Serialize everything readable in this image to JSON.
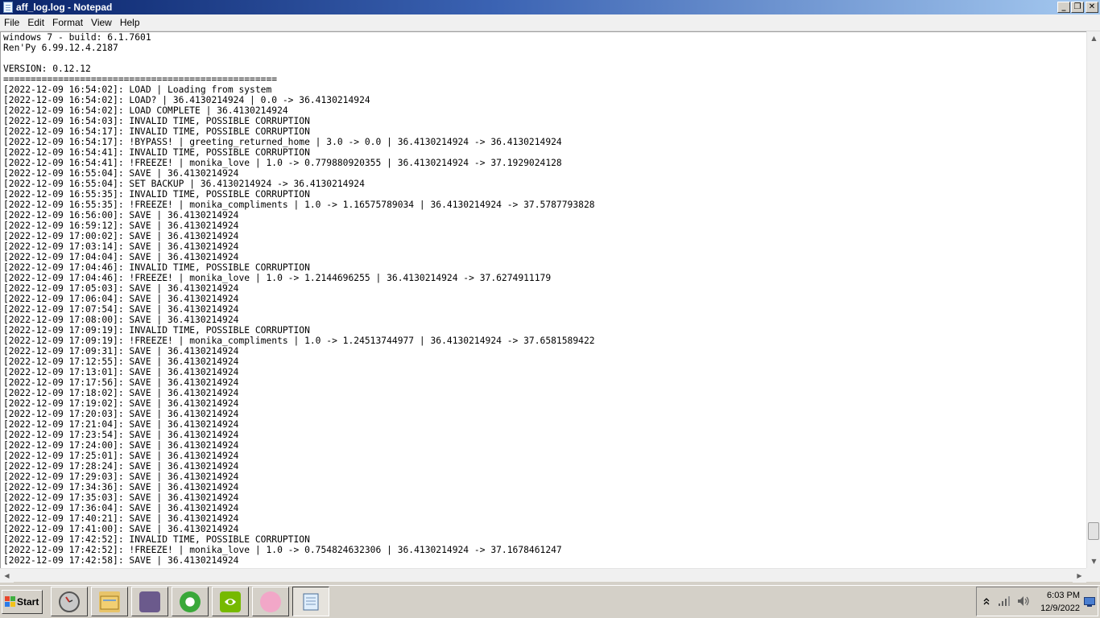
{
  "window": {
    "title": "aff_log.log - Notepad",
    "minimize_glyph": "_",
    "maximize_glyph": "❐",
    "close_glyph": "✕"
  },
  "menu": [
    "File",
    "Edit",
    "Format",
    "View",
    "Help"
  ],
  "document": {
    "lines": [
      "windows 7 - build: 6.1.7601",
      "Ren'Py 6.99.12.4.2187",
      "",
      "VERSION: 0.12.12",
      "==================================================",
      "[2022-12-09 16:54:02]: LOAD | Loading from system",
      "[2022-12-09 16:54:02]: LOAD? | 36.4130214924 | 0.0 -> 36.4130214924",
      "[2022-12-09 16:54:02]: LOAD COMPLETE | 36.4130214924",
      "[2022-12-09 16:54:03]: INVALID TIME, POSSIBLE CORRUPTION",
      "[2022-12-09 16:54:17]: INVALID TIME, POSSIBLE CORRUPTION",
      "[2022-12-09 16:54:17]: !BYPASS! | greeting_returned_home | 3.0 -> 0.0 | 36.4130214924 -> 36.4130214924",
      "[2022-12-09 16:54:41]: INVALID TIME, POSSIBLE CORRUPTION",
      "[2022-12-09 16:54:41]: !FREEZE! | monika_love | 1.0 -> 0.779880920355 | 36.4130214924 -> 37.1929024128",
      "[2022-12-09 16:55:04]: SAVE | 36.4130214924",
      "[2022-12-09 16:55:04]: SET BACKUP | 36.4130214924 -> 36.4130214924",
      "[2022-12-09 16:55:35]: INVALID TIME, POSSIBLE CORRUPTION",
      "[2022-12-09 16:55:35]: !FREEZE! | monika_compliments | 1.0 -> 1.16575789034 | 36.4130214924 -> 37.5787793828",
      "[2022-12-09 16:56:00]: SAVE | 36.4130214924",
      "[2022-12-09 16:59:12]: SAVE | 36.4130214924",
      "[2022-12-09 17:00:02]: SAVE | 36.4130214924",
      "[2022-12-09 17:03:14]: SAVE | 36.4130214924",
      "[2022-12-09 17:04:04]: SAVE | 36.4130214924",
      "[2022-12-09 17:04:46]: INVALID TIME, POSSIBLE CORRUPTION",
      "[2022-12-09 17:04:46]: !FREEZE! | monika_love | 1.0 -> 1.2144696255 | 36.4130214924 -> 37.6274911179",
      "[2022-12-09 17:05:03]: SAVE | 36.4130214924",
      "[2022-12-09 17:06:04]: SAVE | 36.4130214924",
      "[2022-12-09 17:07:54]: SAVE | 36.4130214924",
      "[2022-12-09 17:08:00]: SAVE | 36.4130214924",
      "[2022-12-09 17:09:19]: INVALID TIME, POSSIBLE CORRUPTION",
      "[2022-12-09 17:09:19]: !FREEZE! | monika_compliments | 1.0 -> 1.24513744977 | 36.4130214924 -> 37.6581589422",
      "[2022-12-09 17:09:31]: SAVE | 36.4130214924",
      "[2022-12-09 17:12:55]: SAVE | 36.4130214924",
      "[2022-12-09 17:13:01]: SAVE | 36.4130214924",
      "[2022-12-09 17:17:56]: SAVE | 36.4130214924",
      "[2022-12-09 17:18:02]: SAVE | 36.4130214924",
      "[2022-12-09 17:19:02]: SAVE | 36.4130214924",
      "[2022-12-09 17:20:03]: SAVE | 36.4130214924",
      "[2022-12-09 17:21:04]: SAVE | 36.4130214924",
      "[2022-12-09 17:23:54]: SAVE | 36.4130214924",
      "[2022-12-09 17:24:00]: SAVE | 36.4130214924",
      "[2022-12-09 17:25:01]: SAVE | 36.4130214924",
      "[2022-12-09 17:28:24]: SAVE | 36.4130214924",
      "[2022-12-09 17:29:03]: SAVE | 36.4130214924",
      "[2022-12-09 17:34:36]: SAVE | 36.4130214924",
      "[2022-12-09 17:35:03]: SAVE | 36.4130214924",
      "[2022-12-09 17:36:04]: SAVE | 36.4130214924",
      "[2022-12-09 17:40:21]: SAVE | 36.4130214924",
      "[2022-12-09 17:41:00]: SAVE | 36.4130214924",
      "[2022-12-09 17:42:52]: INVALID TIME, POSSIBLE CORRUPTION",
      "[2022-12-09 17:42:52]: !FREEZE! | monika_love | 1.0 -> 0.754824632306 | 36.4130214924 -> 37.1678461247",
      "[2022-12-09 17:42:58]: SAVE | 36.4130214924"
    ]
  },
  "scrollbars": {
    "up_glyph": "▲",
    "down_glyph": "▼",
    "left_glyph": "◀",
    "right_glyph": "▶",
    "vertical_scroll_position": 0.97
  },
  "taskbar": {
    "start_label": "Start",
    "apps": [
      {
        "name": "clock-app",
        "icon": "clock-icon",
        "color": "#c8c8c8"
      },
      {
        "name": "file-explorer",
        "icon": "folder-icon",
        "color": "#e8c46a"
      },
      {
        "name": "game-app",
        "icon": "anime-character-icon",
        "color": "#6b5a8c"
      },
      {
        "name": "utility-app",
        "icon": "green-circle-app-icon",
        "color": "#3aa83a"
      },
      {
        "name": "nvidia-app",
        "icon": "nvidia-icon",
        "color": "#76b900"
      },
      {
        "name": "pink-app",
        "icon": "pink-app-icon",
        "color": "#f2a7c8"
      },
      {
        "name": "notepad",
        "icon": "notepad-icon",
        "color": "#9cc4e8",
        "active": true
      }
    ],
    "clock_time": "6:03 PM",
    "clock_date": "12/9/2022"
  }
}
